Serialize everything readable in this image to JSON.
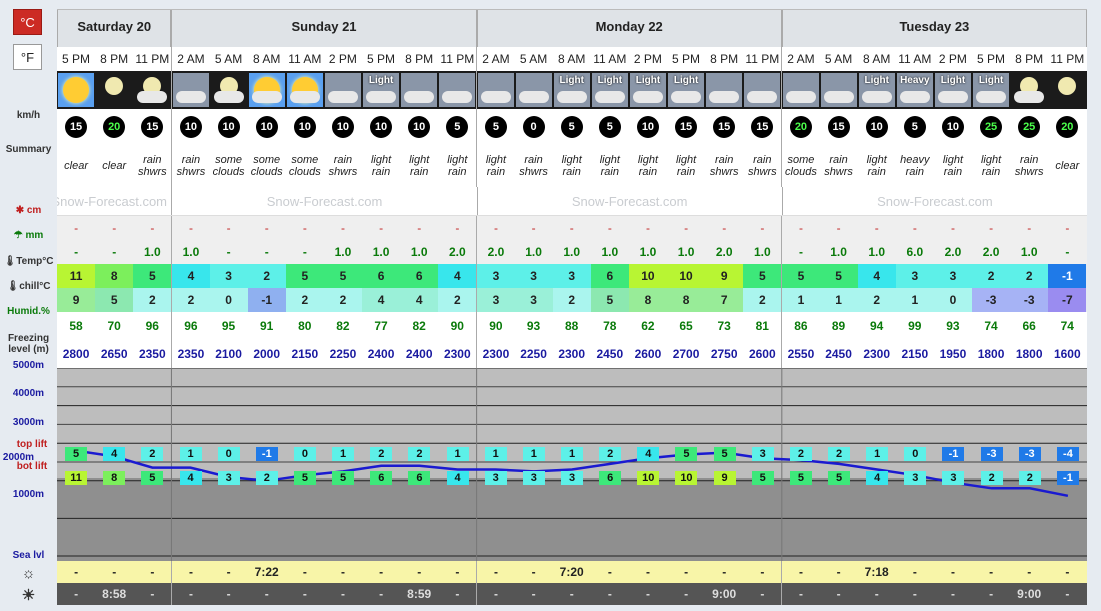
{
  "units": {
    "celsius": "°C",
    "fahrenheit": "°F"
  },
  "labels": {
    "wind": "km/h",
    "summary": "Summary",
    "snow": "cm",
    "rain": "mm",
    "temp": "Temp°C",
    "chill": "chill°C",
    "humid": "Humid.%",
    "freezing": "Freezing level (m)",
    "alt5000": "5000m",
    "alt4000": "4000m",
    "alt3000": "3000m",
    "alt2000": "2000m",
    "alt1000": "1000m",
    "top_lift": "top lift",
    "bot_lift": "bot lift",
    "sea": "Sea lvl"
  },
  "watermark": "Snow-Forecast.com",
  "days": [
    {
      "label": "Saturday 20",
      "cols": 3
    },
    {
      "label": "Sunday 21",
      "cols": 8
    },
    {
      "label": "Monday 22",
      "cols": 8
    },
    {
      "label": "Tuesday 23",
      "cols": 8
    }
  ],
  "times": [
    "5 PM",
    "8 PM",
    "11 PM",
    "2 AM",
    "5 AM",
    "8 AM",
    "11 AM",
    "2 PM",
    "5 PM",
    "8 PM",
    "11 PM",
    "2 AM",
    "5 AM",
    "8 AM",
    "11 AM",
    "2 PM",
    "5 PM",
    "8 PM",
    "11 PM",
    "2 AM",
    "5 AM",
    "8 AM",
    "11 AM",
    "2 PM",
    "5 PM",
    "8 PM",
    "11 PM"
  ],
  "icons": [
    "sun",
    "moon",
    "moon-rain",
    "cloud-rain",
    "moon-cloud",
    "sun-cloud",
    "sun-cloud",
    "cloud-rain",
    "light",
    "rain",
    "rain",
    "rain",
    "rain",
    "light",
    "light",
    "light",
    "light",
    "rain",
    "rain",
    "cloud",
    "rain",
    "light",
    "heavy",
    "light",
    "light",
    "moon-cloud",
    "moon"
  ],
  "icon_text": [
    "",
    "",
    "",
    "",
    "",
    "",
    "",
    "",
    "Light",
    "",
    "",
    "",
    "",
    "Light",
    "Light",
    "Light",
    "Light",
    "",
    "",
    "",
    "",
    "Light",
    "Heavy",
    "Light",
    "Light",
    "",
    ""
  ],
  "wind": [
    15,
    20,
    15,
    10,
    10,
    10,
    10,
    10,
    10,
    10,
    5,
    5,
    0,
    5,
    5,
    10,
    15,
    15,
    15,
    20,
    15,
    10,
    5,
    10,
    25,
    25,
    20
  ],
  "summary": [
    [
      "clear"
    ],
    [
      "clear"
    ],
    [
      "rain",
      "shwrs"
    ],
    [
      "rain",
      "shwrs"
    ],
    [
      "some",
      "clouds"
    ],
    [
      "some",
      "clouds"
    ],
    [
      "some",
      "clouds"
    ],
    [
      "rain",
      "shwrs"
    ],
    [
      "light",
      "rain"
    ],
    [
      "light",
      "rain"
    ],
    [
      "light",
      "rain"
    ],
    [
      "light",
      "rain"
    ],
    [
      "rain",
      "shwrs"
    ],
    [
      "light",
      "rain"
    ],
    [
      "light",
      "rain"
    ],
    [
      "light",
      "rain"
    ],
    [
      "light",
      "rain"
    ],
    [
      "rain",
      "shwrs"
    ],
    [
      "rain",
      "shwrs"
    ],
    [
      "some",
      "clouds"
    ],
    [
      "rain",
      "shwrs"
    ],
    [
      "light",
      "rain"
    ],
    [
      "heavy",
      "rain"
    ],
    [
      "light",
      "rain"
    ],
    [
      "light",
      "rain"
    ],
    [
      "rain",
      "shwrs"
    ],
    [
      "clear"
    ]
  ],
  "snow": [
    "-",
    "-",
    "-",
    "-",
    "-",
    "-",
    "-",
    "-",
    "-",
    "-",
    "-",
    "-",
    "-",
    "-",
    "-",
    "-",
    "-",
    "-",
    "-",
    "-",
    "-",
    "-",
    "-",
    "-",
    "-",
    "-",
    "-"
  ],
  "rain": [
    "-",
    "-",
    "1.0",
    "1.0",
    "-",
    "-",
    "-",
    "1.0",
    "1.0",
    "1.0",
    "2.0",
    "2.0",
    "1.0",
    "1.0",
    "1.0",
    "1.0",
    "1.0",
    "2.0",
    "1.0",
    "-",
    "1.0",
    "1.0",
    "6.0",
    "2.0",
    "2.0",
    "1.0",
    "-"
  ],
  "temp": [
    11,
    8,
    5,
    4,
    3,
    2,
    5,
    5,
    6,
    6,
    4,
    3,
    3,
    3,
    6,
    10,
    10,
    9,
    5,
    5,
    5,
    4,
    3,
    3,
    2,
    2,
    -1
  ],
  "chill": [
    9,
    5,
    2,
    2,
    0,
    -1,
    2,
    2,
    4,
    4,
    2,
    3,
    3,
    2,
    5,
    8,
    8,
    7,
    2,
    1,
    1,
    2,
    1,
    0,
    -3,
    -3,
    -7
  ],
  "humid": [
    58,
    70,
    96,
    96,
    95,
    91,
    80,
    82,
    77,
    82,
    90,
    90,
    93,
    88,
    78,
    62,
    65,
    73,
    81,
    86,
    89,
    94,
    99,
    93,
    74,
    66,
    74
  ],
  "freezing": [
    2800,
    2650,
    2350,
    2350,
    2100,
    2000,
    2150,
    2250,
    2400,
    2400,
    2300,
    2300,
    2250,
    2300,
    2450,
    2600,
    2700,
    2750,
    2600,
    2550,
    2450,
    2300,
    2150,
    1950,
    1800,
    1800,
    1600
  ],
  "top_lift": [
    5,
    4,
    2,
    1,
    0,
    -1,
    0,
    1,
    2,
    2,
    1,
    1,
    1,
    1,
    2,
    4,
    5,
    5,
    3,
    2,
    2,
    1,
    0,
    -1,
    -3,
    -3,
    -4
  ],
  "bot_lift": [
    11,
    8,
    5,
    4,
    3,
    2,
    5,
    5,
    6,
    6,
    4,
    3,
    3,
    3,
    6,
    10,
    10,
    9,
    5,
    5,
    5,
    4,
    3,
    3,
    2,
    2,
    -1
  ],
  "sunrise": [
    "-",
    "-",
    "-",
    "-",
    "-",
    "7:22",
    "-",
    "-",
    "-",
    "-",
    "-",
    "-",
    "-",
    "7:20",
    "-",
    "-",
    "-",
    "-",
    "-",
    "-",
    "-",
    "7:18",
    "-",
    "-",
    "-",
    "-",
    "-"
  ],
  "sunset": [
    "-",
    "8:58",
    "-",
    "-",
    "-",
    "-",
    "-",
    "-",
    "-",
    "8:59",
    "-",
    "-",
    "-",
    "-",
    "-",
    "-",
    "-",
    "9:00",
    "-",
    "-",
    "-",
    "-",
    "-",
    "-",
    "-",
    "9:00",
    "-"
  ],
  "colors": {
    "accent_red": "#cc2b24",
    "rain_green": "#0a7a0a",
    "freezing_blue": "#1a1aa0",
    "sunrise_bg": "#f8f5a8",
    "sunset_bg": "#555555"
  }
}
